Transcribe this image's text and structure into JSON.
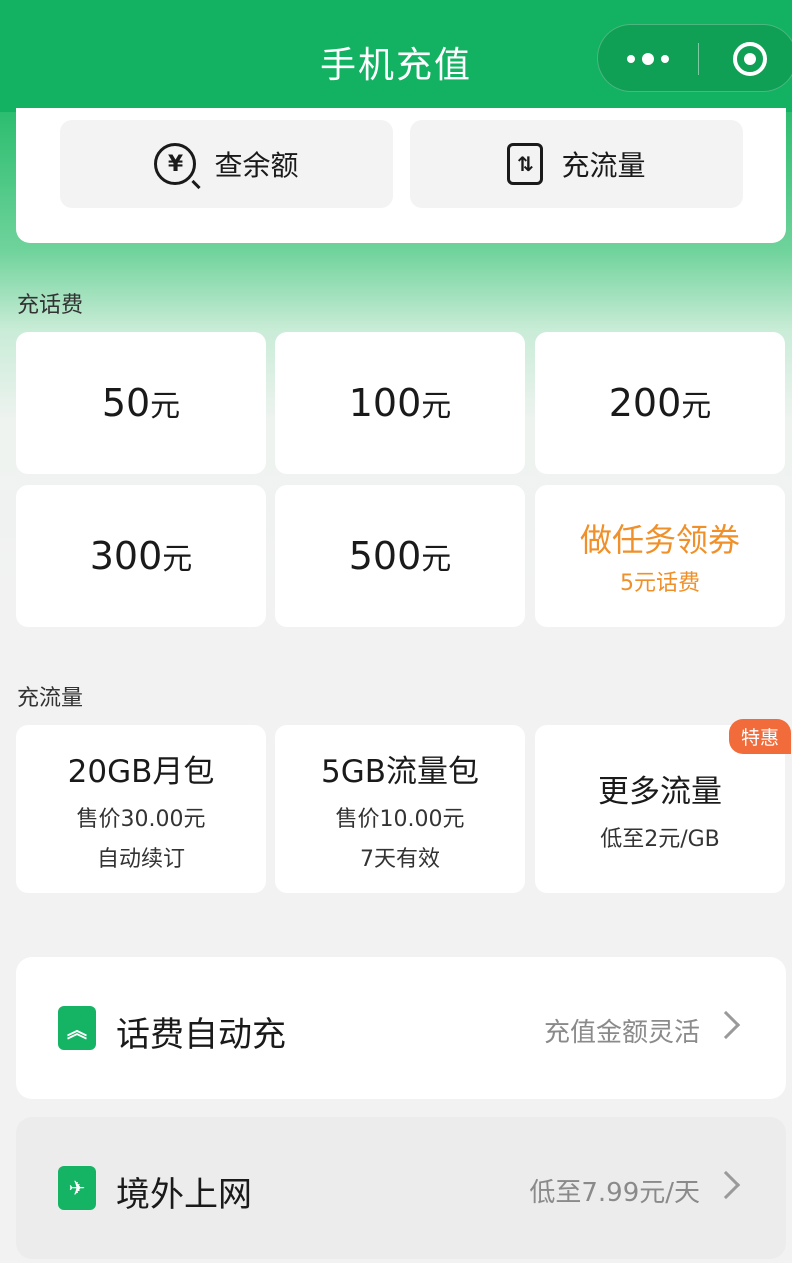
{
  "header": {
    "title": "手机充值"
  },
  "quick_actions": [
    {
      "label": "查余额",
      "icon": "yen-search-icon"
    },
    {
      "label": "充流量",
      "icon": "data-transfer-icon"
    }
  ],
  "topup": {
    "section_label": "充话费",
    "unit": "元",
    "amounts": [
      "50",
      "100",
      "200",
      "300",
      "500"
    ],
    "promo": {
      "main": "做任务领券",
      "sub": "5元话费"
    }
  },
  "data": {
    "section_label": "充流量",
    "packages": [
      {
        "title": "20GB月包",
        "price": "售价30.00元",
        "note": "自动续订"
      },
      {
        "title": "5GB流量包",
        "price": "售价10.00元",
        "note": "7天有效"
      },
      {
        "title": "更多流量",
        "price": "低至2元/GB",
        "badge": "特惠"
      }
    ]
  },
  "services": [
    {
      "title": "话费自动充",
      "desc": "充值金额灵活",
      "icon": "auto-topup-icon"
    },
    {
      "title": "境外上网",
      "desc": "低至7.99元/天",
      "icon": "airplane-icon"
    }
  ],
  "colors": {
    "brand_green": "#13b262",
    "promo_orange": "#f0902a",
    "badge_red": "#f26b3a"
  }
}
